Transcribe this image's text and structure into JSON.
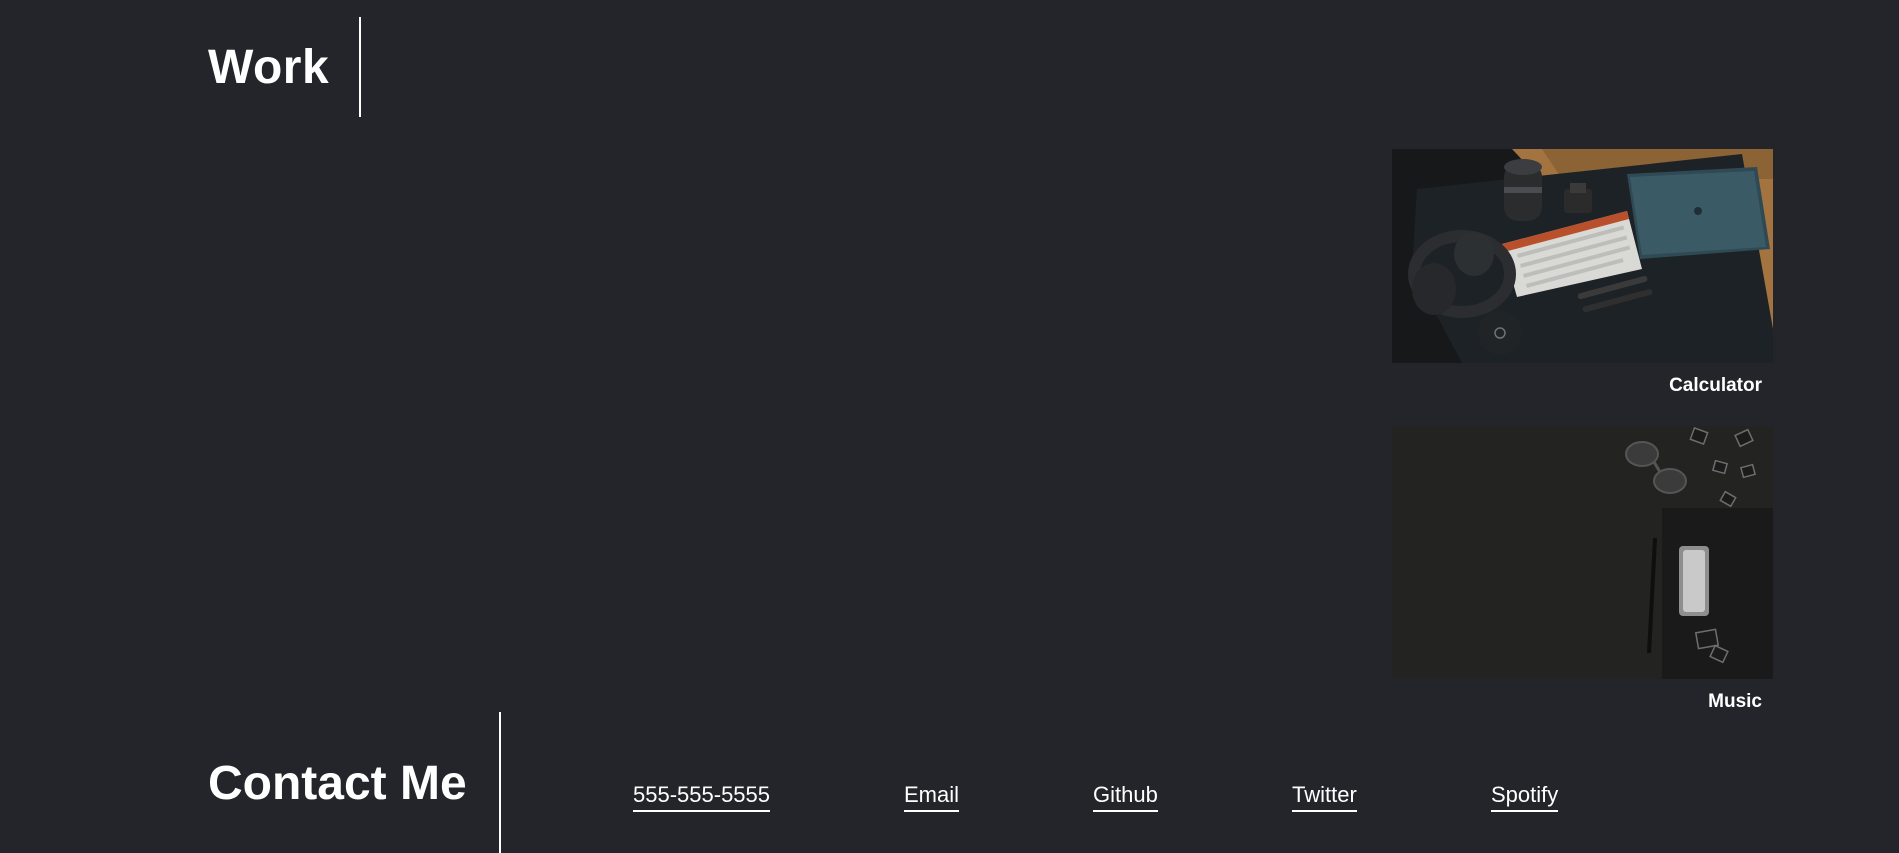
{
  "work": {
    "title": "Work"
  },
  "projects": [
    {
      "name": "Calculator",
      "image": "desk-setup-keyboard-laptop-photo"
    },
    {
      "name": "Music",
      "image": "dark-desk-clipboard-glasses-photo"
    }
  ],
  "contact": {
    "title": "Contact Me",
    "links": {
      "phone": "555-555-5555",
      "email": "Email",
      "github": "Github",
      "twitter": "Twitter",
      "spotify": "Spotify"
    }
  },
  "colors": {
    "background": "#24252a",
    "text": "#ffffff",
    "accent": "#ffffff"
  }
}
